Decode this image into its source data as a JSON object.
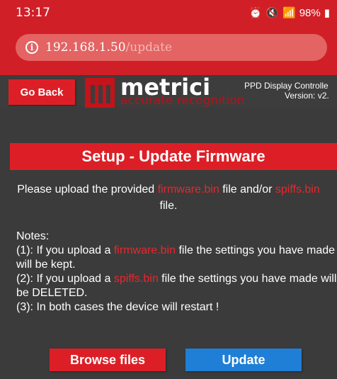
{
  "status_bar": {
    "time": "13:17",
    "battery": "98%",
    "icons": [
      "alarm-icon",
      "mute-icon",
      "wifi-icon",
      "signal-icon",
      "battery-icon"
    ]
  },
  "browser": {
    "url_host": "192.168.1.50",
    "url_path": "/update"
  },
  "header": {
    "go_back": "Go Back",
    "logo_text": "metrici",
    "logo_tagline": "accurate recognition",
    "device_name": "PPD Display Controlle",
    "device_version": "Version: v2."
  },
  "banner": {
    "title": "Setup - Update Firmware"
  },
  "content": {
    "intro_1": "Please upload the provided ",
    "intro_file1": "firmware.bin",
    "intro_2": " file and/or ",
    "intro_file2": "spiffs.bin",
    "intro_3": " file.",
    "notes_title": "Notes:",
    "note1_a": "(1): If you upload a ",
    "note1_file": "firmware.bin",
    "note1_b": " file the settings you have made will be kept.",
    "note2_a": "(2): If you upload a ",
    "note2_file": "spiffs.bin",
    "note2_b": " file the settings you have made will be DELETED.",
    "note3": "(3): In both cases the device will restart !"
  },
  "actions": {
    "browse": "Browse files",
    "update": "Update"
  },
  "colors": {
    "brand_red": "#dc1f26",
    "update_blue": "#1f7fd6",
    "background": "#3b3b3b"
  }
}
